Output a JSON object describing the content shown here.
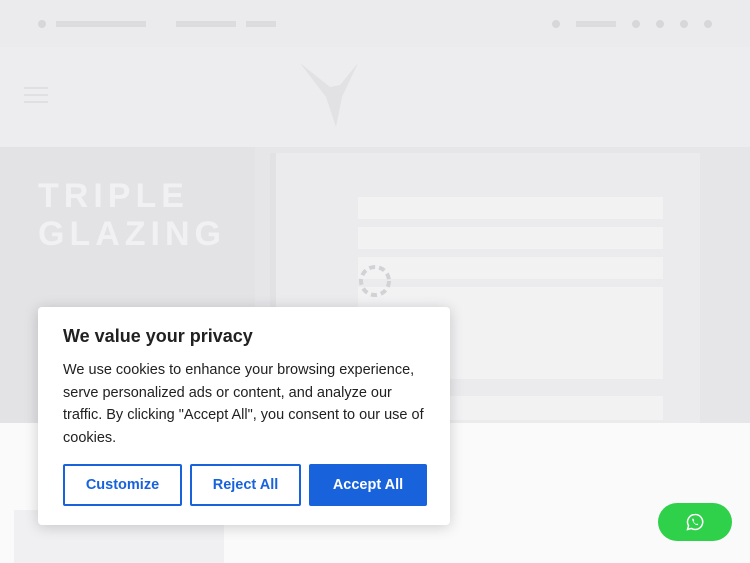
{
  "cookie": {
    "title": "We value your privacy",
    "text": "We use cookies to enhance your browsing experience, serve personalized ads or content, and analyze our traffic. By clicking \"Accept All\", you consent to our use of cookies.",
    "customize_label": "Customize",
    "reject_label": "Reject All",
    "accept_label": "Accept All"
  },
  "hero": {
    "title_line1": "TRIPLE",
    "title_line2": "GLAZING"
  },
  "colors": {
    "accent": "#1863dc",
    "whatsapp": "#2fd04a"
  },
  "icons": {
    "whatsapp": "whatsapp-icon",
    "spinner": "loading-spinner-icon",
    "menu": "hamburger-menu-icon",
    "logo": "eagle-logo-icon"
  }
}
